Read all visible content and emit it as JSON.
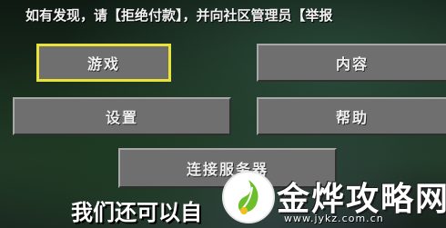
{
  "notice": "如有发现，请【拒绝付款】，并向社区管理员【举报",
  "menu": {
    "game": "游戏",
    "content": "内容",
    "settings": "设置",
    "help": "帮助",
    "connect": "连接服务器"
  },
  "bottom_text": "我们还可以自",
  "watermark": {
    "title": "金烨攻略网",
    "url": "www.jykz.com.cn"
  },
  "colors": {
    "selection_outline": "#e8e23a",
    "button_face": "#6f6f6f",
    "logo_green": "#6cbf2a"
  }
}
